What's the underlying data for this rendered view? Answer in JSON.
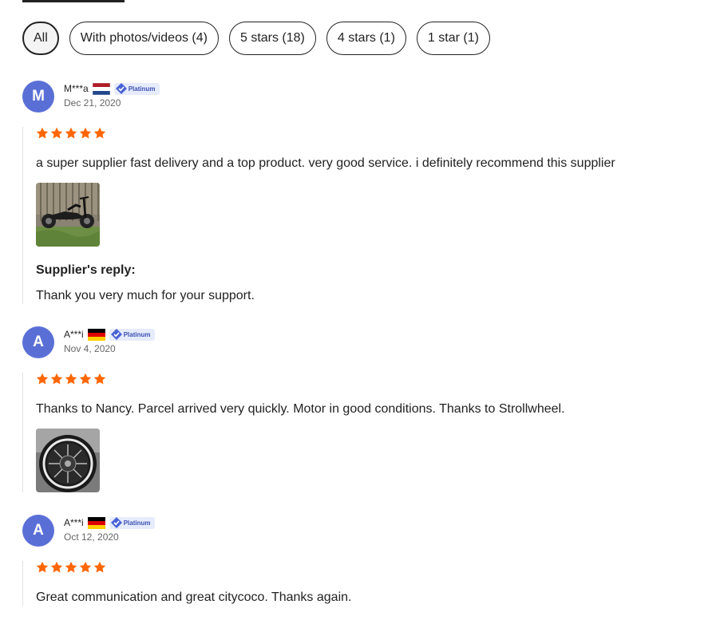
{
  "filters": [
    {
      "label": "All",
      "active": true
    },
    {
      "label": "With photos/videos (4)",
      "active": false
    },
    {
      "label": "5 stars (18)",
      "active": false
    },
    {
      "label": "4 stars (1)",
      "active": false
    },
    {
      "label": "1 star (1)",
      "active": false
    }
  ],
  "colors": {
    "star": "#ff6600",
    "avatar": "#5a6fd6",
    "badge_bg": "#e6ecfb",
    "badge_text": "#3b4fb4"
  },
  "reviews": [
    {
      "initial": "M",
      "user": "M***a",
      "country_flag": "netherlands",
      "badge": "Platinum",
      "date": "Dec 21, 2020",
      "rating": 5,
      "text": "a super supplier fast delivery and a top product. very good service. i definitely recommend this supplier",
      "photo": "scooter-photo",
      "reply_title": "Supplier's reply:",
      "reply_text": "Thank you very much for your support."
    },
    {
      "initial": "A",
      "user": "A***i",
      "country_flag": "germany",
      "badge": "Platinum",
      "date": "Nov 4, 2020",
      "rating": 5,
      "text": "Thanks to Nancy. Parcel arrived very quickly. Motor in good conditions. Thanks to Strollwheel.",
      "photo": "motor-wheel-photo"
    },
    {
      "initial": "A",
      "user": "A***i",
      "country_flag": "germany",
      "badge": "Platinum",
      "date": "Oct 12, 2020",
      "rating": 5,
      "text": "Great communication and great citycoco. Thanks again."
    }
  ]
}
